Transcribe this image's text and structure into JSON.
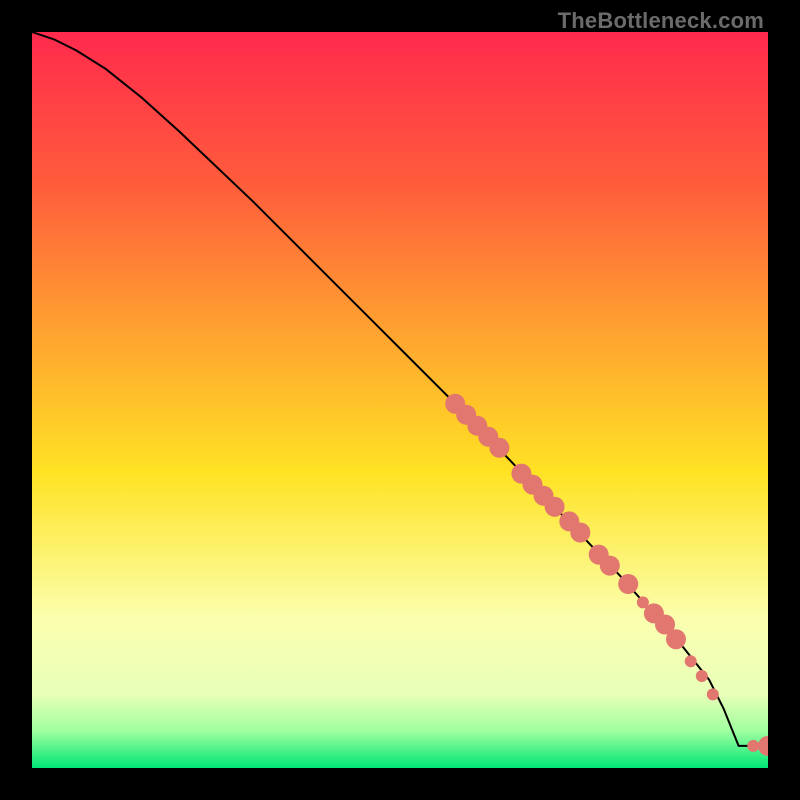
{
  "watermark": "TheBottleneck.com",
  "chart_data": {
    "type": "line",
    "title": "",
    "xlabel": "",
    "ylabel": "",
    "xlim": [
      0,
      100
    ],
    "ylim": [
      0,
      100
    ],
    "background_gradient": [
      {
        "stop": 0.0,
        "color": "#ff2a4d"
      },
      {
        "stop": 0.2,
        "color": "#ff5a3c"
      },
      {
        "stop": 0.42,
        "color": "#ffa72f"
      },
      {
        "stop": 0.6,
        "color": "#ffe324"
      },
      {
        "stop": 0.8,
        "color": "#fbffb0"
      },
      {
        "stop": 0.9,
        "color": "#e8ffb8"
      },
      {
        "stop": 0.95,
        "color": "#9fff9f"
      },
      {
        "stop": 1.0,
        "color": "#00e676"
      }
    ],
    "series": [
      {
        "name": "curve",
        "color": "#000000",
        "stroke_width": 2,
        "x": [
          0,
          3,
          6,
          10,
          15,
          20,
          30,
          40,
          50,
          60,
          70,
          80,
          88,
          92,
          94,
          96,
          100
        ],
        "y": [
          100,
          99,
          97.5,
          95,
          91,
          86.5,
          77,
          67,
          57,
          47,
          36.5,
          26,
          17,
          12,
          8,
          3,
          3
        ]
      }
    ],
    "markers": {
      "color": "#e2776f",
      "radius_small": 6,
      "radius_large": 10,
      "points": [
        {
          "x": 57.5,
          "y": 49.5,
          "r": "large"
        },
        {
          "x": 59.0,
          "y": 48.0,
          "r": "large"
        },
        {
          "x": 60.5,
          "y": 46.5,
          "r": "large"
        },
        {
          "x": 62.0,
          "y": 45.0,
          "r": "large"
        },
        {
          "x": 63.5,
          "y": 43.5,
          "r": "large"
        },
        {
          "x": 66.5,
          "y": 40.0,
          "r": "large"
        },
        {
          "x": 68.0,
          "y": 38.5,
          "r": "large"
        },
        {
          "x": 69.5,
          "y": 37.0,
          "r": "large"
        },
        {
          "x": 71.0,
          "y": 35.5,
          "r": "large"
        },
        {
          "x": 73.0,
          "y": 33.5,
          "r": "large"
        },
        {
          "x": 74.5,
          "y": 32.0,
          "r": "large"
        },
        {
          "x": 77.0,
          "y": 29.0,
          "r": "large"
        },
        {
          "x": 78.5,
          "y": 27.5,
          "r": "large"
        },
        {
          "x": 81.0,
          "y": 25.0,
          "r": "large"
        },
        {
          "x": 83.0,
          "y": 22.5,
          "r": "small"
        },
        {
          "x": 84.5,
          "y": 21.0,
          "r": "large"
        },
        {
          "x": 86.0,
          "y": 19.5,
          "r": "large"
        },
        {
          "x": 87.5,
          "y": 17.5,
          "r": "large"
        },
        {
          "x": 89.5,
          "y": 14.5,
          "r": "small"
        },
        {
          "x": 91.0,
          "y": 12.5,
          "r": "small"
        },
        {
          "x": 92.5,
          "y": 10.0,
          "r": "small"
        },
        {
          "x": 98.0,
          "y": 3.0,
          "r": "small"
        },
        {
          "x": 100.0,
          "y": 3.0,
          "r": "large"
        }
      ]
    }
  }
}
